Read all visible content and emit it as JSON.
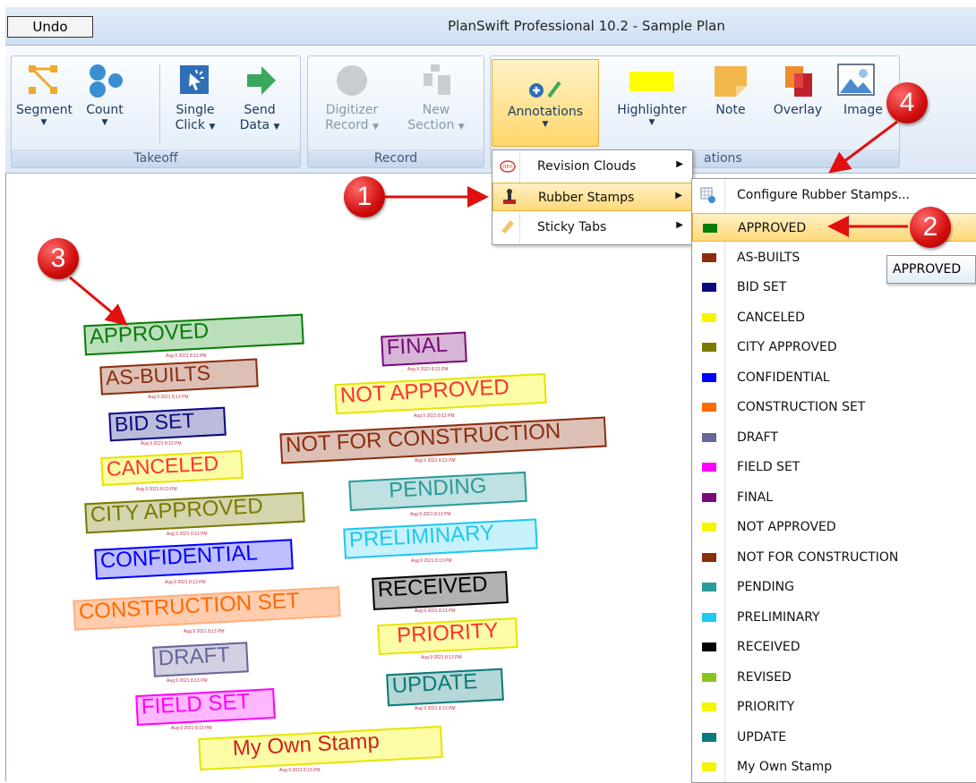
{
  "titlebar": {
    "undo_label": "Undo",
    "app_title": "PlanSwift Professional 10.2 - Sample Plan"
  },
  "ribbon": {
    "takeoff": {
      "label": "Takeoff",
      "buttons": [
        "Segment",
        "Count",
        "Single",
        "Click",
        "Send",
        "Data"
      ]
    },
    "record": {
      "label": "Record",
      "buttons": [
        "Digitizer",
        "Record",
        "New",
        "Section"
      ]
    },
    "annotations": {
      "label": "ations",
      "buttons": [
        "Annotations",
        "Highlighter",
        "Note",
        "Overlay",
        "Image"
      ]
    }
  },
  "annotations_menu": [
    "Revision Clouds",
    "Rubber Stamps",
    "Sticky Tabs"
  ],
  "stamps_menu": {
    "configure": "Configure Rubber Stamps...",
    "items": [
      "APPROVED",
      "AS-BUILTS",
      "BID SET",
      "CANCELED",
      "CITY APPROVED",
      "CONFIDENTIAL",
      "CONSTRUCTION SET",
      "DRAFT",
      "FIELD SET",
      "FINAL",
      "NOT APPROVED",
      "NOT FOR CONSTRUCTION",
      "PENDING",
      "PRELIMINARY",
      "RECEIVED",
      "REVISED",
      "PRIORITY",
      "UPDATE",
      "My Own Stamp"
    ],
    "colors": [
      "#0a7c0a",
      "#8b2e0e",
      "#0a0a80",
      "#f5f500",
      "#7a7a00",
      "#0000ff",
      "#ff6a00",
      "#66669a",
      "#ff00ff",
      "#7a0a7a",
      "#f5f500",
      "#8b2e0e",
      "#2a9a9a",
      "#1ec8f0",
      "#000000",
      "#8cc31e",
      "#f5f500",
      "#0a7a7a",
      "#f5f500"
    ]
  },
  "tooltip": "APPROVED",
  "callouts": [
    "1",
    "2",
    "3",
    "4"
  ],
  "canvas_stamps": [
    "APPROVED",
    "AS-BUILTS",
    "BID SET",
    "CANCELED",
    "CITY APPROVED",
    "CONFIDENTIAL",
    "CONSTRUCTION SET",
    "DRAFT",
    "FIELD SET",
    "My Own Stamp",
    "FINAL",
    "NOT APPROVED",
    "NOT FOR CONSTRUCTION",
    "PENDING",
    "PRELIMINARY",
    "RECEIVED",
    "PRIORITY",
    "UPDATE"
  ]
}
